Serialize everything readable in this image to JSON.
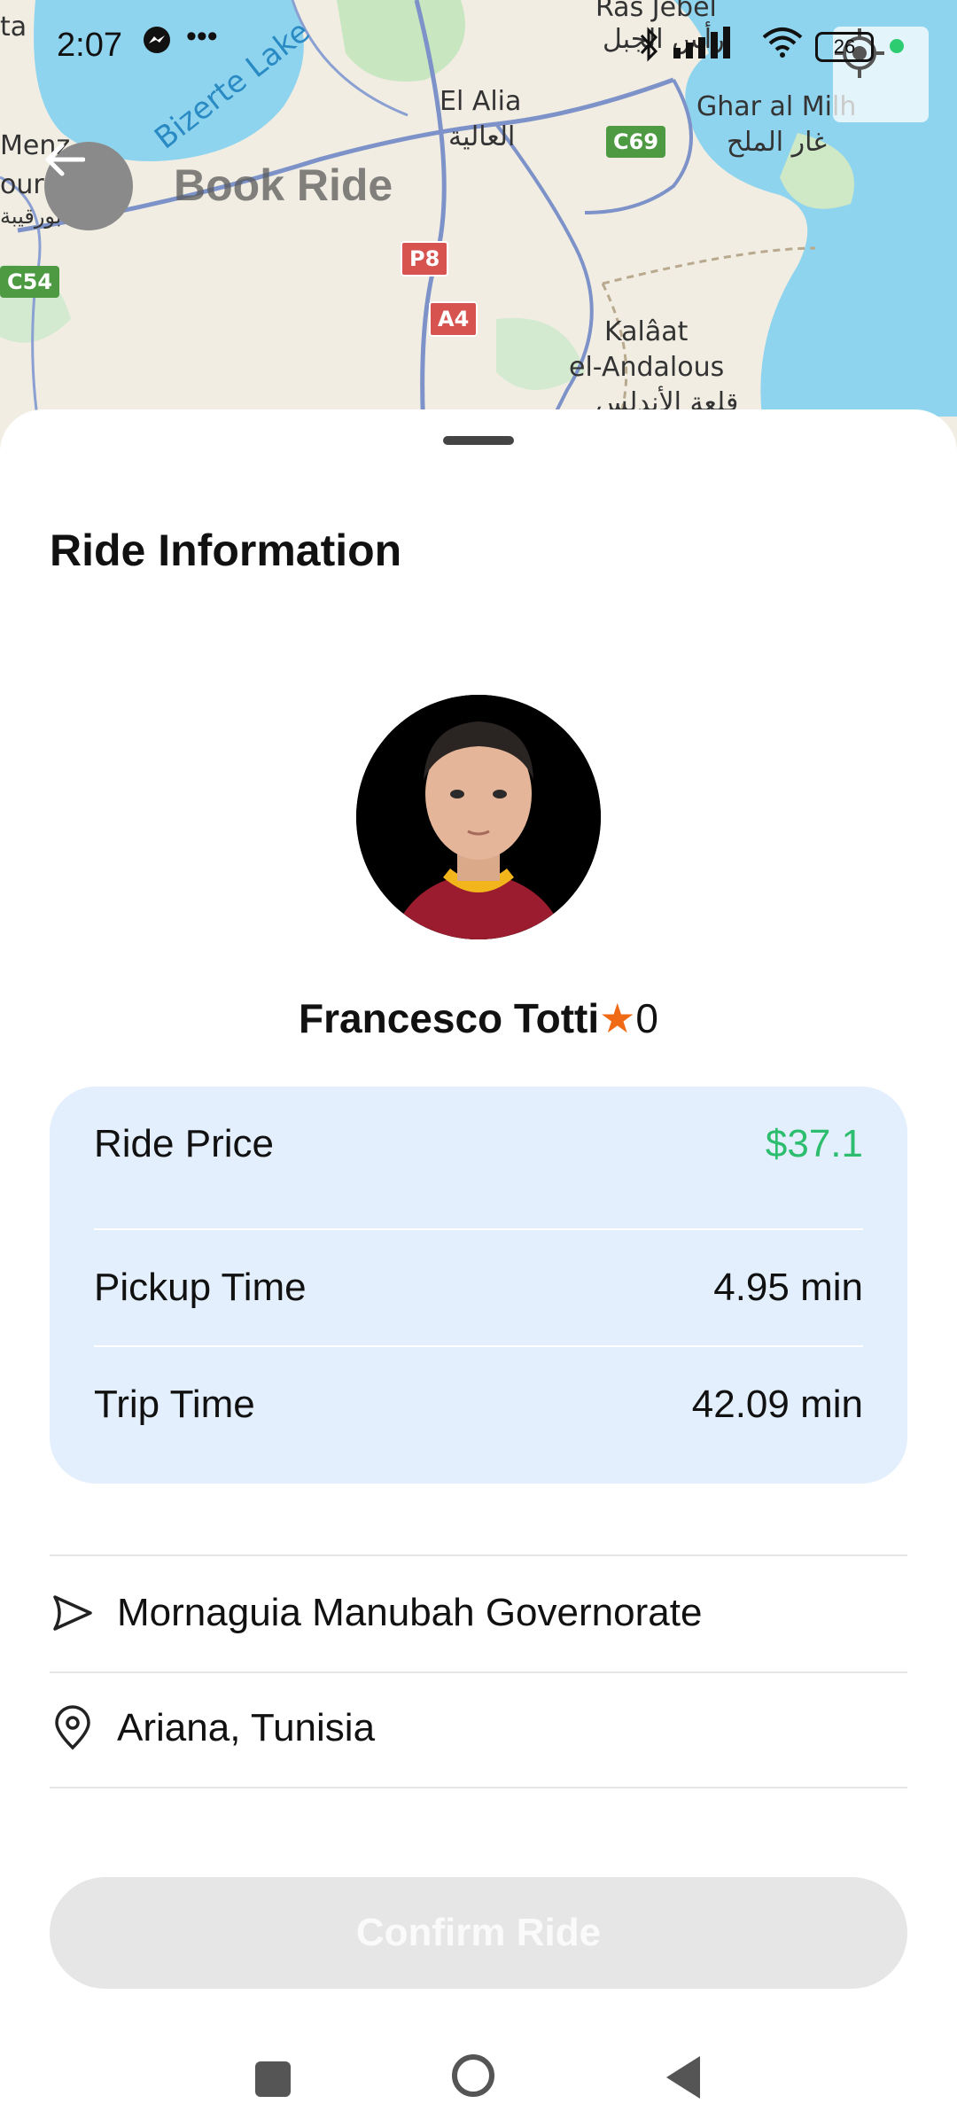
{
  "status_bar": {
    "time": "2:07",
    "battery": "26"
  },
  "map": {
    "title": "Book Ride",
    "labels": {
      "lake": "Bizerte Lake",
      "el_alia": "El Alia",
      "el_alia_ar": "العالية",
      "ras_jebel": "Ras Jebel",
      "ras_jebel_ar": "رأس الجبل",
      "ghar_al_milh": "Ghar al Milh",
      "ghar_al_milh_ar": "غار الملح",
      "kalaat": "Kalâat",
      "el_andalous": "el-Andalous",
      "kalaat_ar": "قلعة الأندلس",
      "menzel": "Menz",
      "bourg": "ourg",
      "bourg_ar": "منزل بورقيبة",
      "ta": "ta"
    },
    "roads": {
      "c54": "C54",
      "c69": "C69",
      "p8": "P8",
      "a4": "A4"
    }
  },
  "sheet": {
    "title": "Ride Information",
    "driver": {
      "name": "Francesco Totti",
      "rating": "0"
    },
    "info": [
      {
        "label": "Ride Price",
        "value": "$37.1"
      },
      {
        "label": "Pickup Time",
        "value": "4.95 min"
      },
      {
        "label": "Trip Time",
        "value": "42.09 min"
      }
    ],
    "pickup": "Mornaguia Manubah Governorate",
    "destination": "Ariana, Tunisia",
    "confirm_label": "Confirm Ride"
  },
  "colors": {
    "price": "#2cbe6e",
    "star": "#f06a16",
    "card": "#e3effc"
  }
}
